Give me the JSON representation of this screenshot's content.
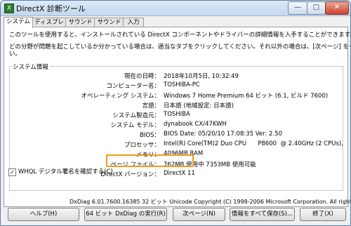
{
  "window": {
    "title": "DirectX 診断ツール",
    "icon": "directx-app-icon",
    "controls": {
      "minimize": "—",
      "maximize": "□",
      "close": "✕"
    }
  },
  "tabs": [
    {
      "label": "システム",
      "active": true
    },
    {
      "label": "ディスプレイ",
      "active": false
    },
    {
      "label": "サウンド 1",
      "active": false
    },
    {
      "label": "サウンド 2",
      "active": false
    },
    {
      "label": "入力",
      "active": false
    }
  ],
  "intro": {
    "line1": "このツールを使用すると、インストールされている DirectX コンポーネントやドライバーの詳細情報を入手することができます。",
    "line2": "どの分野が問題を起こしているか分かっている場合は、適当なタブをクリックしてください。それ以外の場合は、[次ページ] をクリックしてくださ",
    "line3": "い。"
  },
  "system_info": {
    "group_label": "システム情報",
    "rows": [
      {
        "label": "現在の日時：",
        "value": "2018年10月5日, 10:32:49"
      },
      {
        "label": "コンピューター名：",
        "value": "TOSHIBA-PC"
      },
      {
        "label": "オペレーティング システム：",
        "value": "Windows 7 Home Premium 64 ビット (6.1, ビルド 7600)"
      },
      {
        "label": "言語：",
        "value": "日本語 (地域設定: 日本語)"
      },
      {
        "label": "システム製造元：",
        "value": "TOSHIBA"
      },
      {
        "label": "システム モデル：",
        "value": "dynabook CX/47KWH"
      },
      {
        "label": "BIOS：",
        "value": "BIOS Date: 05/20/10 17:08:35 Ver: 2.50"
      },
      {
        "label": "プロセッサ：",
        "value": "Intel(R) Core(TM)2 Duo CPU      P8600  @ 2.40GHz (2 CPUs),"
      },
      {
        "label": "メモリ：",
        "value": "4096MB RAM"
      },
      {
        "label": "ページ ファイル：",
        "value": "762MB 使用中 7353MB 使用可能"
      },
      {
        "label": "DirectX バージョン：",
        "value": "DirectX 11"
      }
    ]
  },
  "whql_checkbox": {
    "label": "WHQL デジタル署名を確認する(C)",
    "checked": true
  },
  "footer_text": "DxDiag 6.01.7600.16385 32 ビット Unicode  Copyright (C) 1998-2006 Microsoft Corporation.  All rights reserved.",
  "buttons": {
    "help": "ヘルプ(H)",
    "run64": "64 ビット DxDiag の実行(R)",
    "next": "次ページ(N)",
    "save": "情報をすべて保存(S)...",
    "exit": "終了(X)"
  },
  "highlight_color": "#f39a1b"
}
